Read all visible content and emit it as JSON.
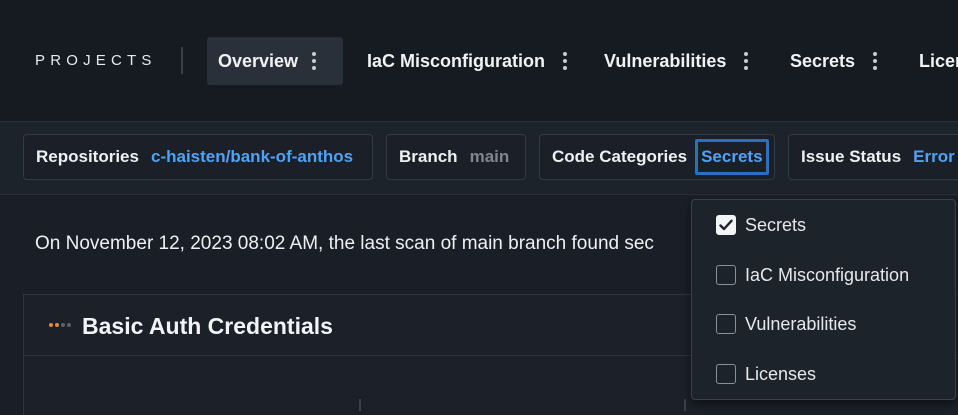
{
  "nav": {
    "brand": "PROJECTS",
    "tabs": [
      {
        "label": "Overview",
        "active": true
      },
      {
        "label": "IaC Misconfiguration"
      },
      {
        "label": "Vulnerabilities"
      },
      {
        "label": "Secrets"
      },
      {
        "label": "Licer"
      }
    ]
  },
  "filters": {
    "repositories": {
      "label": "Repositories",
      "value": "c-haisten/bank-of-anthos"
    },
    "branch": {
      "label": "Branch",
      "value": "main"
    },
    "code_categories": {
      "label": "Code Categories",
      "value": "Secrets"
    },
    "issue_status": {
      "label": "Issue Status",
      "value": "Error"
    }
  },
  "main": {
    "scan_summary": "On November 12, 2023 08:02 AM, the last scan of main branch found sec",
    "card": {
      "title": "Basic Auth Credentials"
    }
  },
  "dropdown": {
    "options": [
      {
        "label": "Secrets",
        "checked": true
      },
      {
        "label": "IaC Misconfiguration",
        "checked": false
      },
      {
        "label": "Vulnerabilities",
        "checked": false
      },
      {
        "label": "Licenses",
        "checked": false
      }
    ]
  },
  "colors": {
    "accent": "#4ea3f7",
    "focus_border": "#2a6fc0",
    "background": "#1a1f27",
    "severity_dot": "#e8893a"
  }
}
